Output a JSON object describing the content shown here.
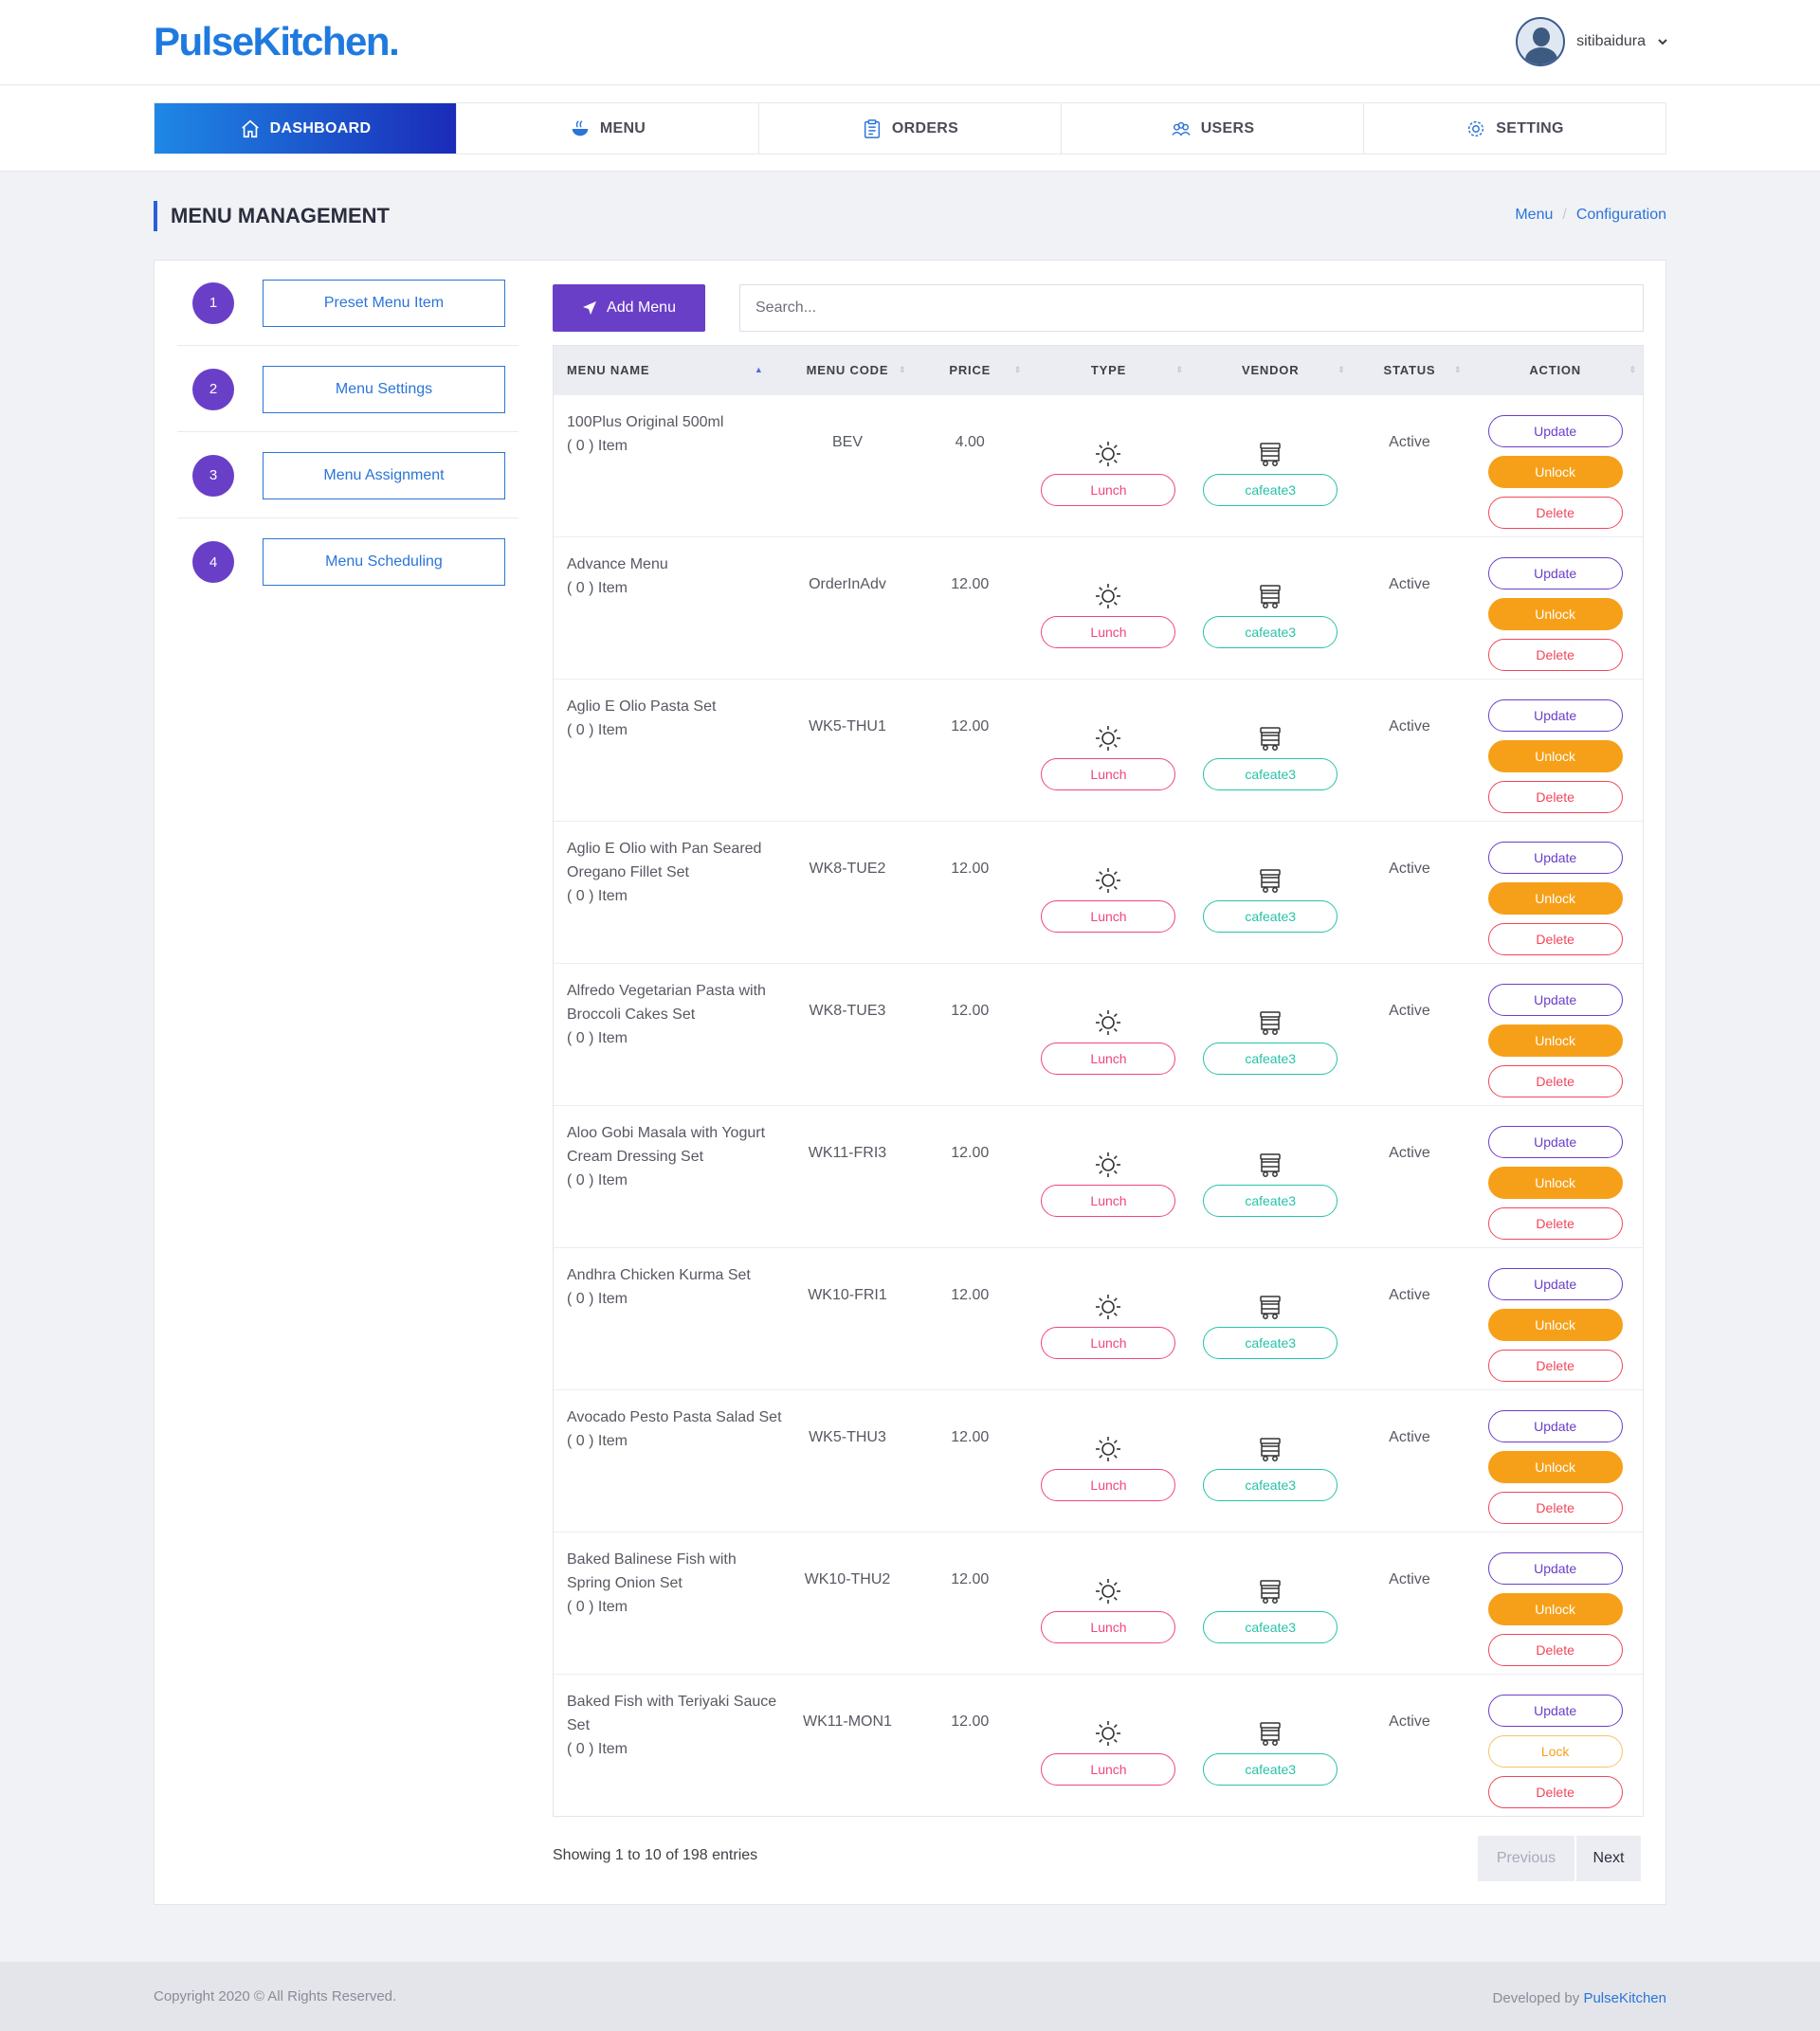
{
  "brand": {
    "logo": "PulseKitchen."
  },
  "user": {
    "name": "sitibaidura",
    "caret": "⌄"
  },
  "nav": [
    {
      "label": "DASHBOARD",
      "icon": "home-icon",
      "active": true
    },
    {
      "label": "MENU",
      "icon": "food-icon",
      "active": false
    },
    {
      "label": "ORDERS",
      "icon": "clipboard-icon",
      "active": false
    },
    {
      "label": "USERS",
      "icon": "users-icon",
      "active": false
    },
    {
      "label": "SETTING",
      "icon": "gear-icon",
      "active": false
    }
  ],
  "page": {
    "title": "MENU MANAGEMENT"
  },
  "breadcrumb": {
    "first": "Menu",
    "separator": "/",
    "second": "Configuration"
  },
  "steps": [
    {
      "num": "1",
      "label": "Preset Menu Item"
    },
    {
      "num": "2",
      "label": "Menu Settings"
    },
    {
      "num": "3",
      "label": "Menu Assignment"
    },
    {
      "num": "4",
      "label": "Menu Scheduling"
    }
  ],
  "toolbar": {
    "add_label": "Add Menu",
    "search_placeholder": "Search..."
  },
  "table": {
    "headers": {
      "name": "MENU NAME",
      "code": "MENU CODE",
      "price": "PRICE",
      "type": "TYPE",
      "vendor": "VENDOR",
      "status": "STATUS",
      "action": "ACTION"
    },
    "rows": [
      {
        "name": "100Plus Original 500ml",
        "qty": "( 0 ) Item",
        "code": "BEV",
        "price": "4.00",
        "type": "Lunch",
        "vendor": "cafeate3",
        "status": "Active",
        "update": "Update",
        "lock": "Unlock",
        "lock_state": "unlock",
        "delete": "Delete"
      },
      {
        "name": "Advance Menu",
        "qty": "( 0 ) Item",
        "code": "OrderInAdv",
        "price": "12.00",
        "type": "Lunch",
        "vendor": "cafeate3",
        "status": "Active",
        "update": "Update",
        "lock": "Unlock",
        "lock_state": "unlock",
        "delete": "Delete"
      },
      {
        "name": "Aglio E Olio Pasta Set",
        "qty": "( 0 ) Item",
        "code": "WK5-THU1",
        "price": "12.00",
        "type": "Lunch",
        "vendor": "cafeate3",
        "status": "Active",
        "update": "Update",
        "lock": "Unlock",
        "lock_state": "unlock",
        "delete": "Delete"
      },
      {
        "name": "Aglio E Olio with Pan Seared Oregano Fillet Set",
        "qty": "( 0 ) Item",
        "code": "WK8-TUE2",
        "price": "12.00",
        "type": "Lunch",
        "vendor": "cafeate3",
        "status": "Active",
        "update": "Update",
        "lock": "Unlock",
        "lock_state": "unlock",
        "delete": "Delete"
      },
      {
        "name": "Alfredo Vegetarian Pasta with Broccoli Cakes Set",
        "qty": "( 0 ) Item",
        "code": "WK8-TUE3",
        "price": "12.00",
        "type": "Lunch",
        "vendor": "cafeate3",
        "status": "Active",
        "update": "Update",
        "lock": "Unlock",
        "lock_state": "unlock",
        "delete": "Delete"
      },
      {
        "name": "Aloo Gobi Masala with Yogurt Cream Dressing Set",
        "qty": "( 0 ) Item",
        "code": "WK11-FRI3",
        "price": "12.00",
        "type": "Lunch",
        "vendor": "cafeate3",
        "status": "Active",
        "update": "Update",
        "lock": "Unlock",
        "lock_state": "unlock",
        "delete": "Delete"
      },
      {
        "name": "Andhra Chicken Kurma Set",
        "qty": "( 0 ) Item",
        "code": "WK10-FRI1",
        "price": "12.00",
        "type": "Lunch",
        "vendor": "cafeate3",
        "status": "Active",
        "update": "Update",
        "lock": "Unlock",
        "lock_state": "unlock",
        "delete": "Delete"
      },
      {
        "name": "Avocado Pesto Pasta Salad Set",
        "qty": "( 0 ) Item",
        "code": "WK5-THU3",
        "price": "12.00",
        "type": "Lunch",
        "vendor": "cafeate3",
        "status": "Active",
        "update": "Update",
        "lock": "Unlock",
        "lock_state": "unlock",
        "delete": "Delete"
      },
      {
        "name": "Baked Balinese Fish with Spring Onion Set",
        "qty": "( 0 ) Item",
        "code": "WK10-THU2",
        "price": "12.00",
        "type": "Lunch",
        "vendor": "cafeate3",
        "status": "Active",
        "update": "Update",
        "lock": "Unlock",
        "lock_state": "unlock",
        "delete": "Delete"
      },
      {
        "name": "Baked Fish with Teriyaki Sauce Set",
        "qty": "( 0 ) Item",
        "code": "WK11-MON1",
        "price": "12.00",
        "type": "Lunch",
        "vendor": "cafeate3",
        "status": "Active",
        "update": "Update",
        "lock": "Lock",
        "lock_state": "lock",
        "delete": "Delete"
      }
    ]
  },
  "pagination": {
    "info": "Showing 1 to 10 of 198 entries",
    "previous": "Previous",
    "next": "Next"
  },
  "footer": {
    "copyright": "Copyright 2020 © All Rights Reserved.",
    "developed_by": "Developed by",
    "developer": "PulseKitchen"
  }
}
